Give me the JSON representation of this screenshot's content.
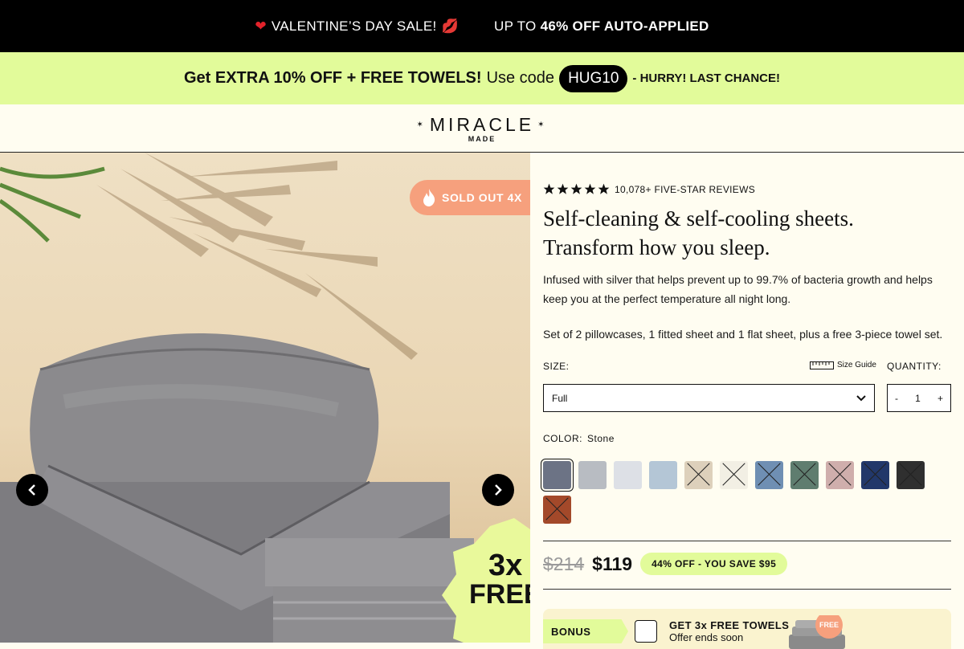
{
  "topbar": {
    "sale_text": "VALENTINE’S DAY SALE!",
    "upto_text": "UP TO",
    "off_text": "46% OFF AUTO-APPLIED"
  },
  "promo": {
    "headline": "Get EXTRA 10% OFF + FREE TOWELS!",
    "use_code": "Use code",
    "code": "HUG10",
    "hurry": "- HURRY! LAST CHANCE!"
  },
  "header": {
    "logo_main": "MIRACLE",
    "logo_sub": "MADE"
  },
  "hero": {
    "sold_badge": "SOLD OUT 4X",
    "free_badge_line1": "3x",
    "free_badge_line2": "FREE"
  },
  "product": {
    "reviews": "10,078+ FIVE-STAR REVIEWS",
    "rating": 5,
    "title": "Self-cleaning & self-cooling sheets. Transform how you sleep.",
    "description": "Infused with silver that helps prevent up to 99.7% of bacteria growth and helps keep you at the perfect temperature all night long.",
    "set_info": "Set of 2 pillowcases, 1 fitted sheet and 1 flat sheet, plus a free 3-piece towel set.",
    "size_label": "SIZE:",
    "size_guide": "Size Guide",
    "size_value": "Full",
    "quantity_label": "QUANTITY:",
    "qty_minus": "-",
    "qty_value": "1",
    "qty_plus": "+",
    "color_label": "COLOR:",
    "color_value": "Stone",
    "swatches": [
      {
        "color": "#6c7385",
        "selected": true,
        "soldout": false
      },
      {
        "color": "#b8bcc2",
        "selected": false,
        "soldout": false
      },
      {
        "color": "#dde0e6",
        "selected": false,
        "soldout": false
      },
      {
        "color": "#b4c6d6",
        "selected": false,
        "soldout": false
      },
      {
        "color": "#ddd0bb",
        "selected": false,
        "soldout": true
      },
      {
        "color": "#f2efe4",
        "selected": false,
        "soldout": true
      },
      {
        "color": "#6f8fb3",
        "selected": false,
        "soldout": true
      },
      {
        "color": "#5f7d6f",
        "selected": false,
        "soldout": true
      },
      {
        "color": "#cfaeac",
        "selected": false,
        "soldout": true
      },
      {
        "color": "#22386a",
        "selected": false,
        "soldout": true
      },
      {
        "color": "#2f2f2f",
        "selected": false,
        "soldout": true
      },
      {
        "color": "#a3492a",
        "selected": false,
        "soldout": true
      }
    ],
    "old_price": "$214",
    "new_price": "$119",
    "discount": "44% OFF - YOU SAVE $95"
  },
  "bonus": {
    "tag": "BONUS",
    "title": "GET 3x FREE TOWELS",
    "subtitle": "Offer ends soon",
    "free_label": "FREE"
  },
  "colors": {
    "accent": "#e2fb9a",
    "badge": "#f6a07d",
    "background": "#fffdf1"
  }
}
